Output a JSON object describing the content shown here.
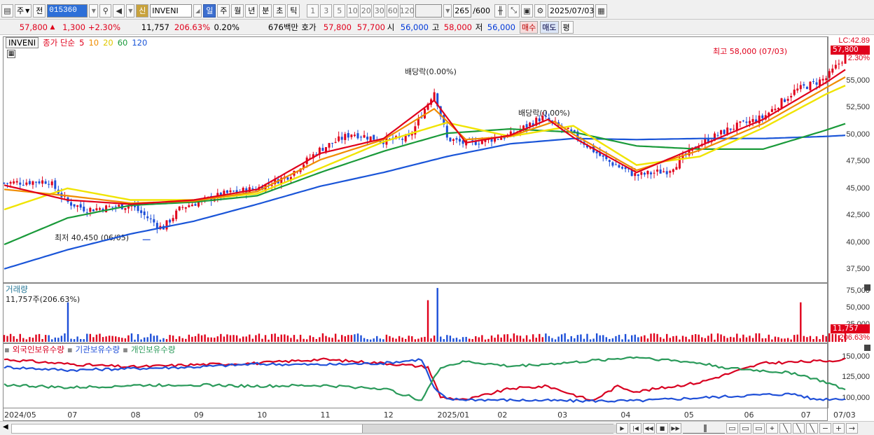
{
  "toolbar": {
    "period_label": "주",
    "prev_label": "전",
    "stock_code": "015360",
    "shin_label": "신",
    "stock_name": "INVENI",
    "period_buttons": [
      "일",
      "주",
      "월",
      "년",
      "분",
      "초",
      "틱"
    ],
    "interval_buttons": [
      "1",
      "3",
      "5",
      "10",
      "20",
      "30",
      "60",
      "120"
    ],
    "count_value": "265",
    "count_max": "/600",
    "date_value": "2025/07/03"
  },
  "quote": {
    "price": "57,800",
    "change": "1,300",
    "change_pct": "+2.30%",
    "volume": "11,757",
    "volume_ratio": "206.63%",
    "turnover": "0.20%",
    "amount": "676백만",
    "bid_label": "호가",
    "ask_price": "57,800",
    "bid_price": "57,700",
    "open_label": "시",
    "open": "56,000",
    "high_label": "고",
    "high": "58,000",
    "low_label": "저",
    "low": "56,000",
    "buy_label": "매수",
    "sell_label": "매도",
    "equal_label": "평"
  },
  "price_panel": {
    "stock_label": "INVENI",
    "ma_title": "종가 단순",
    "ma_periods": [
      {
        "label": "5",
        "color": "#e0001b"
      },
      {
        "label": "10",
        "color": "#f08c00"
      },
      {
        "label": "20",
        "color": "#e8e000"
      },
      {
        "label": "60",
        "color": "#1a9a3a"
      },
      {
        "label": "120",
        "color": "#1a55d8"
      }
    ],
    "y_ticks": [
      "55,000",
      "52,500",
      "50,000",
      "47,500",
      "45,000",
      "42,500",
      "40,000",
      "37,500"
    ],
    "lc_label": "LC:42.89",
    "last_price_tag": "57,800",
    "last_change_tag": "2.30%",
    "high_annotation": "최고 58,000 (07/03)",
    "low_annotation": "최저 40,450 (06/05)",
    "dividend_annotation_1": "배당락(0.00%)",
    "dividend_annotation_2": "배당락(0.00%)"
  },
  "volume_panel": {
    "title": "거래량",
    "current": "11,757주(206.63%)",
    "y_ticks": [
      "75,000",
      "50,000",
      "25,000"
    ],
    "last_volume_tag": "11,757",
    "last_ratio_tag": "206.63%"
  },
  "holdings_panel": {
    "legend": [
      {
        "label": "외국인보유수량",
        "color": "#d80020"
      },
      {
        "label": "기관보유수량",
        "color": "#2050d8"
      },
      {
        "label": "개인보유수량",
        "color": "#2a9a5a"
      }
    ],
    "y_ticks": [
      "150,000",
      "125,000",
      "100,000"
    ]
  },
  "x_axis": {
    "labels": [
      "2024/05",
      "07",
      "08",
      "09",
      "10",
      "11",
      "12",
      "2025/01",
      "02",
      "03",
      "04",
      "05",
      "06",
      "07"
    ],
    "right_label": "07/03"
  },
  "chart_data": [
    {
      "type": "candlestick",
      "title": "INVENI 종가 단순",
      "y_axis": {
        "ylim": [
          36500,
          59500
        ],
        "ticks": [
          37500,
          40000,
          42500,
          45000,
          47500,
          50000,
          52500,
          55000
        ]
      },
      "x": [
        "2024/05",
        "07",
        "08",
        "09",
        "10",
        "11",
        "12",
        "2025/01",
        "02",
        "03",
        "04",
        "05",
        "06",
        "07"
      ],
      "close_path": [
        [
          0,
          45800
        ],
        [
          0.7,
          46000
        ],
        [
          1,
          44000
        ],
        [
          1.3,
          43300
        ],
        [
          2,
          43700
        ],
        [
          2.5,
          41500
        ],
        [
          2.8,
          43500
        ],
        [
          3.5,
          44800
        ],
        [
          4,
          45300
        ],
        [
          4.5,
          46500
        ],
        [
          5,
          49000
        ],
        [
          5.5,
          50500
        ],
        [
          6,
          49800
        ],
        [
          6.4,
          50000
        ],
        [
          6.8,
          54500
        ],
        [
          7,
          50000
        ],
        [
          7.3,
          49500
        ],
        [
          8,
          50300
        ],
        [
          8.5,
          52000
        ],
        [
          9,
          50400
        ],
        [
          9.5,
          48000
        ],
        [
          10,
          46500
        ],
        [
          10.5,
          47000
        ],
        [
          11,
          49500
        ],
        [
          11.5,
          51000
        ],
        [
          12,
          52000
        ],
        [
          12.5,
          54500
        ],
        [
          13,
          55700
        ],
        [
          13.3,
          57800
        ]
      ],
      "moving_averages": [
        {
          "name": "5",
          "values": [
            [
              0,
              45600
            ],
            [
              1,
              44200
            ],
            [
              2,
              43800
            ],
            [
              3,
              44200
            ],
            [
              4,
              45200
            ],
            [
              5,
              48600
            ],
            [
              6,
              50000
            ],
            [
              6.8,
              53600
            ],
            [
              7.3,
              49600
            ],
            [
              8,
              50300
            ],
            [
              8.6,
              51800
            ],
            [
              9,
              50100
            ],
            [
              10,
              46800
            ],
            [
              11,
              49300
            ],
            [
              12,
              51800
            ],
            [
              13,
              55300
            ],
            [
              13.3,
              56500
            ]
          ]
        },
        {
          "name": "10",
          "values": [
            [
              0,
              45200
            ],
            [
              1,
              44600
            ],
            [
              2,
              43900
            ],
            [
              3,
              44100
            ],
            [
              4,
              45000
            ],
            [
              5,
              48000
            ],
            [
              6,
              49900
            ],
            [
              6.8,
              52800
            ],
            [
              7.3,
              49900
            ],
            [
              8,
              50200
            ],
            [
              8.7,
              51600
            ],
            [
              9,
              50400
            ],
            [
              10,
              47000
            ],
            [
              11,
              48900
            ],
            [
              12,
              51400
            ],
            [
              13,
              54800
            ],
            [
              13.3,
              55800
            ]
          ]
        },
        {
          "name": "20",
          "values": [
            [
              0,
              43300
            ],
            [
              1,
              45300
            ],
            [
              2,
              44200
            ],
            [
              3,
              44200
            ],
            [
              4,
              44800
            ],
            [
              5,
              47200
            ],
            [
              6,
              49700
            ],
            [
              7,
              51500
            ],
            [
              8,
              50200
            ],
            [
              9,
              51200
            ],
            [
              10,
              47500
            ],
            [
              11,
              48300
            ],
            [
              12,
              51000
            ],
            [
              13,
              54200
            ],
            [
              13.3,
              55000
            ]
          ]
        },
        {
          "name": "60",
          "values": [
            [
              0,
              40000
            ],
            [
              1,
              42500
            ],
            [
              2,
              43700
            ],
            [
              3,
              44000
            ],
            [
              4,
              44600
            ],
            [
              5,
              46800
            ],
            [
              6,
              48800
            ],
            [
              7,
              50500
            ],
            [
              8,
              50900
            ],
            [
              9,
              50600
            ],
            [
              10,
              49300
            ],
            [
              11,
              49000
            ],
            [
              12,
              49000
            ],
            [
              13,
              50800
            ],
            [
              13.3,
              51400
            ]
          ]
        },
        {
          "name": "120",
          "values": [
            [
              0,
              37700
            ],
            [
              1,
              39500
            ],
            [
              2,
              41000
            ],
            [
              3,
              42200
            ],
            [
              4,
              43800
            ],
            [
              5,
              45500
            ],
            [
              6,
              46800
            ],
            [
              7,
              48300
            ],
            [
              8,
              49500
            ],
            [
              9,
              50000
            ],
            [
              10,
              49900
            ],
            [
              11,
              50000
            ],
            [
              12,
              50000
            ],
            [
              13,
              50200
            ],
            [
              13.3,
              50300
            ]
          ]
        }
      ]
    },
    {
      "type": "bar",
      "title": "거래량",
      "ylim": [
        0,
        80000
      ],
      "y_ticks": [
        25000,
        50000,
        75000
      ],
      "notable": [
        {
          "x": 1.0,
          "value": 55000
        },
        {
          "x": 6.7,
          "value": 58000
        },
        {
          "x": 6.85,
          "value": 75000
        },
        {
          "x": 12.6,
          "value": 55000
        },
        {
          "x": 13.3,
          "value": 11757
        }
      ]
    },
    {
      "type": "line",
      "title": "보유수량",
      "ylim": [
        88000,
        160000
      ],
      "y_ticks": [
        100000,
        125000,
        150000
      ],
      "series": [
        {
          "name": "외국인보유수량",
          "values": [
            [
              0,
              150000
            ],
            [
              1,
              144000
            ],
            [
              2,
              140000
            ],
            [
              3,
              143000
            ],
            [
              4,
              145000
            ],
            [
              5,
              150000
            ],
            [
              6,
              145000
            ],
            [
              6.7,
              140000
            ],
            [
              6.9,
              101000
            ],
            [
              7.3,
              97000
            ],
            [
              8,
              112000
            ],
            [
              8.6,
              115000
            ],
            [
              9.3,
              96000
            ],
            [
              9.7,
              115000
            ],
            [
              10,
              108000
            ],
            [
              11,
              120000
            ],
            [
              12,
              145000
            ],
            [
              13,
              148000
            ],
            [
              13.3,
              150000
            ]
          ]
        },
        {
          "name": "기관보유수량",
          "values": [
            [
              0,
              140000
            ],
            [
              1,
              136000
            ],
            [
              2,
              138000
            ],
            [
              3,
              140000
            ],
            [
              4,
              144000
            ],
            [
              5,
              143000
            ],
            [
              6,
              145000
            ],
            [
              6.6,
              150000
            ],
            [
              6.8,
              112000
            ],
            [
              7,
              98000
            ],
            [
              8,
              97000
            ],
            [
              9,
              96000
            ],
            [
              10,
              96000
            ],
            [
              11,
              100000
            ],
            [
              12,
              104000
            ],
            [
              12.5,
              105000
            ],
            [
              12.8,
              98000
            ],
            [
              13.3,
              99000
            ]
          ]
        },
        {
          "name": "개인보유수량",
          "values": [
            [
              0,
              117000
            ],
            [
              1,
              113000
            ],
            [
              2,
              116000
            ],
            [
              3,
              117000
            ],
            [
              4,
              115000
            ],
            [
              5,
              116000
            ],
            [
              6,
              112000
            ],
            [
              6.6,
              97000
            ],
            [
              6.9,
              140000
            ],
            [
              7.3,
              147000
            ],
            [
              8,
              141000
            ],
            [
              9,
              146000
            ],
            [
              10,
              153000
            ],
            [
              11,
              145000
            ],
            [
              11.5,
              138000
            ],
            [
              12,
              135000
            ],
            [
              12.5,
              132000
            ],
            [
              13,
              120000
            ],
            [
              13.3,
              110000
            ]
          ]
        }
      ]
    }
  ]
}
